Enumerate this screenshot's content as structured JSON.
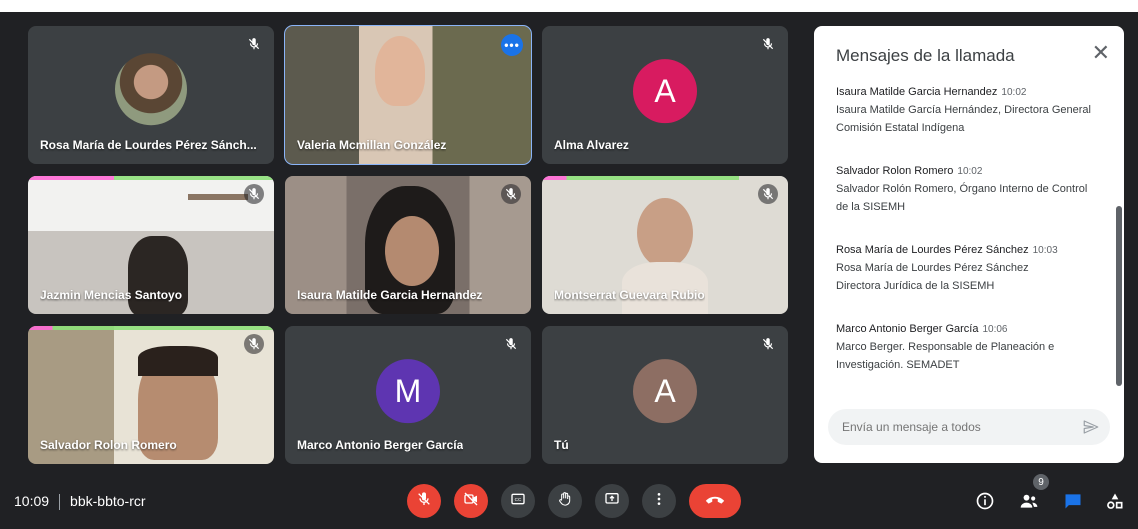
{
  "colors": {
    "background": "#202124",
    "tile": "#3c4043",
    "active_outline": "#8ab4f8",
    "hangup_red": "#ea4335",
    "chat_blue": "#1a73e8",
    "avatar_alma": "#d81b60",
    "avatar_marco": "#5e35b1",
    "avatar_tu": "#8d6e63"
  },
  "participants": [
    {
      "name": "Rosa María de Lourdes Pérez Sánch...",
      "type": "photo-avatar",
      "muted": true
    },
    {
      "name": "Valeria Mcmillan González",
      "type": "video",
      "muted": false,
      "active": true
    },
    {
      "name": "Alma Alvarez",
      "type": "letter-avatar",
      "letter": "A",
      "muted": true
    },
    {
      "name": "Jazmin Mencias Santoyo",
      "type": "video",
      "muted": true
    },
    {
      "name": "Isaura Matilde Garcia Hernandez",
      "type": "video",
      "muted": true
    },
    {
      "name": "Montserrat Guevara Rubio",
      "type": "video",
      "muted": true
    },
    {
      "name": "Salvador Rolon Romero",
      "type": "video",
      "muted": true
    },
    {
      "name": "Marco Antonio Berger García",
      "type": "letter-avatar",
      "letter": "M",
      "muted": true
    },
    {
      "name": "Tú",
      "type": "letter-avatar",
      "letter": "A",
      "muted": true
    }
  ],
  "chat": {
    "title": "Mensajes de la llamada",
    "messages": [
      {
        "sender": "Isaura Matilde Garcia Hernandez",
        "time": "10:02",
        "text": "Isaura Matilde García Hernández, Directora General\nComisión Estatal Indígena"
      },
      {
        "sender": "Salvador Rolon Romero",
        "time": "10:02",
        "text": "Salvador Rolón Romero, Órgano Interno de Control\nde la SISEMH"
      },
      {
        "sender": "Rosa María de Lourdes Pérez Sánchez",
        "time": "10:03",
        "text": "Rosa María de Lourdes Pérez Sánchez\nDirectora Jurídica de la SISEMH"
      },
      {
        "sender": "Marco Antonio Berger García",
        "time": "10:06",
        "text": "Marco Berger. Responsable de Planeación e\nInvestigación. SEMADET"
      }
    ],
    "input_placeholder": "Envía un mensaje a todos"
  },
  "bottombar": {
    "time": "10:09",
    "meeting_code": "bbk-bbto-rcr",
    "participant_count": "9"
  },
  "icons": {
    "mic_off": "mic-off-icon",
    "cam_off": "camera-off-icon",
    "captions": "captions-icon",
    "raise_hand": "raise-hand-icon",
    "present": "present-screen-icon",
    "more": "more-options-icon",
    "hangup": "hangup-icon",
    "info": "info-icon",
    "people": "people-icon",
    "chat": "chat-icon",
    "activities": "activities-icon"
  }
}
